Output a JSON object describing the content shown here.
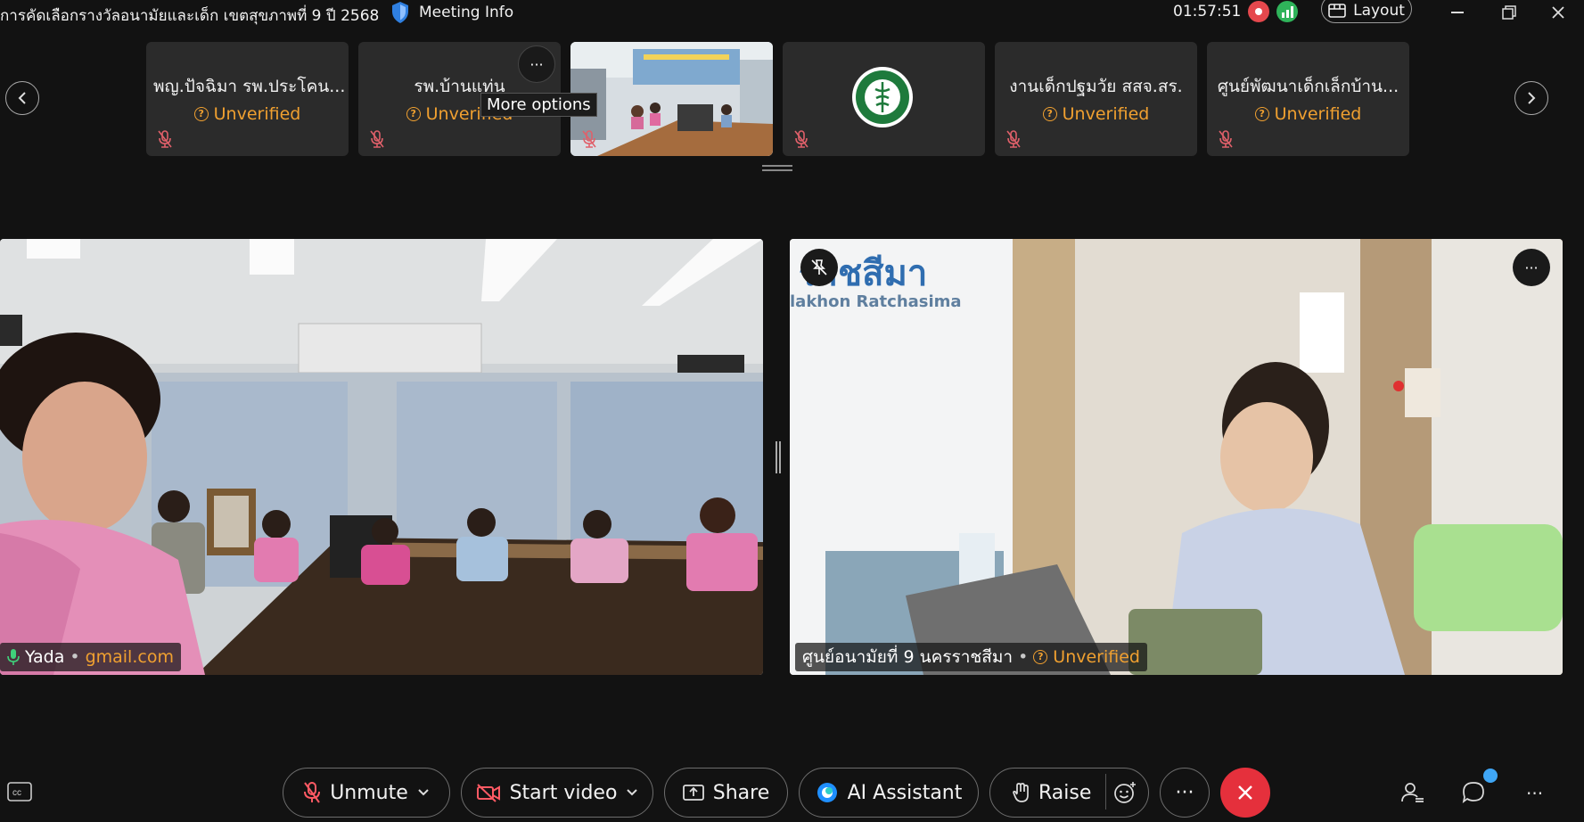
{
  "titlebar": {
    "meeting_title": "การคัดเลือกรางวัลอนามัยและเด็ก เขตสุขภาพที่ 9 ปี 2568",
    "meeting_info": "Meeting Info",
    "clock": "01:57:51",
    "layout_label": "Layout"
  },
  "filmstrip": {
    "tiles": [
      {
        "name": "พญ.ปัจฉิมา รพ.ประโคน...",
        "status": "Unverified"
      },
      {
        "name": "รพ.บ้านแท่น",
        "status": "Unverified"
      },
      {
        "name": "",
        "status": ""
      },
      {
        "name": "",
        "status": ""
      },
      {
        "name": "งานเด็กปฐมวัย สสจ.สร.",
        "status": "Unverified"
      },
      {
        "name": "ศูนย์พัฒนาเด็กเล็กบ้าน...",
        "status": "Unverified"
      }
    ],
    "tooltip": "More options"
  },
  "main": {
    "left": {
      "name": "Yada",
      "email": "gmail.com"
    },
    "right": {
      "name": "ศูนย์อนามัยที่ 9 นครราชสีมา",
      "status": "Unverified",
      "sign_text": "ราชสีมา",
      "sign_sub": "lakhon Ratchasima"
    }
  },
  "toolbar": {
    "unmute": "Unmute",
    "start_video": "Start video",
    "share": "Share",
    "ai_assistant": "AI Assistant",
    "raise": "Raise"
  },
  "colors": {
    "background": "#121212",
    "unverified": "#f0a030",
    "end_call": "#e5303c",
    "muted_icon": "#e0606a",
    "notification": "#3fa6f5"
  }
}
